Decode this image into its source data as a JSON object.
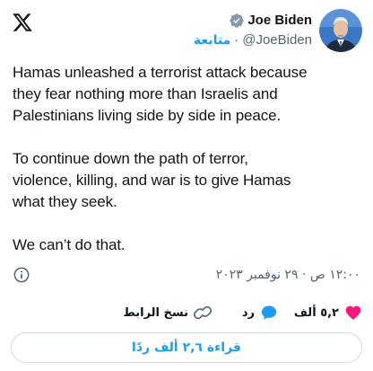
{
  "header": {
    "logo_icon": "x-logo-icon"
  },
  "author": {
    "name": "Joe Biden",
    "handle": "@JoeBiden",
    "follow_label": "متابعة",
    "separator": "·",
    "verified_icon": "verified-badge-icon",
    "verified_color": "#1d9bf0"
  },
  "tweet": {
    "text": "Hamas unleashed a terrorist attack because\nthey fear nothing more than Israelis and\nPalestinians living side by side in peace.\n\nTo continue down the path of terror,\nviolence, killing, and war is to give Hamas\nwhat they seek.\n\nWe can’t do that.",
    "timestamp": "١٢:٠٠ ص · ٢٩ نوفمبر ٢٠٢٣",
    "info_icon": "info-icon"
  },
  "actions": {
    "like_count": "٥,٢ ألف",
    "like_icon": "heart-icon",
    "like_color": "#f91880",
    "reply_label": "رد",
    "reply_icon": "reply-bubble-icon",
    "reply_color": "#1d9bf0",
    "copy_link_label": "نسخ الرابط",
    "copy_link_icon": "link-icon"
  },
  "read_replies": {
    "label": "قراءة ٢,٦ ألف ردًا"
  }
}
